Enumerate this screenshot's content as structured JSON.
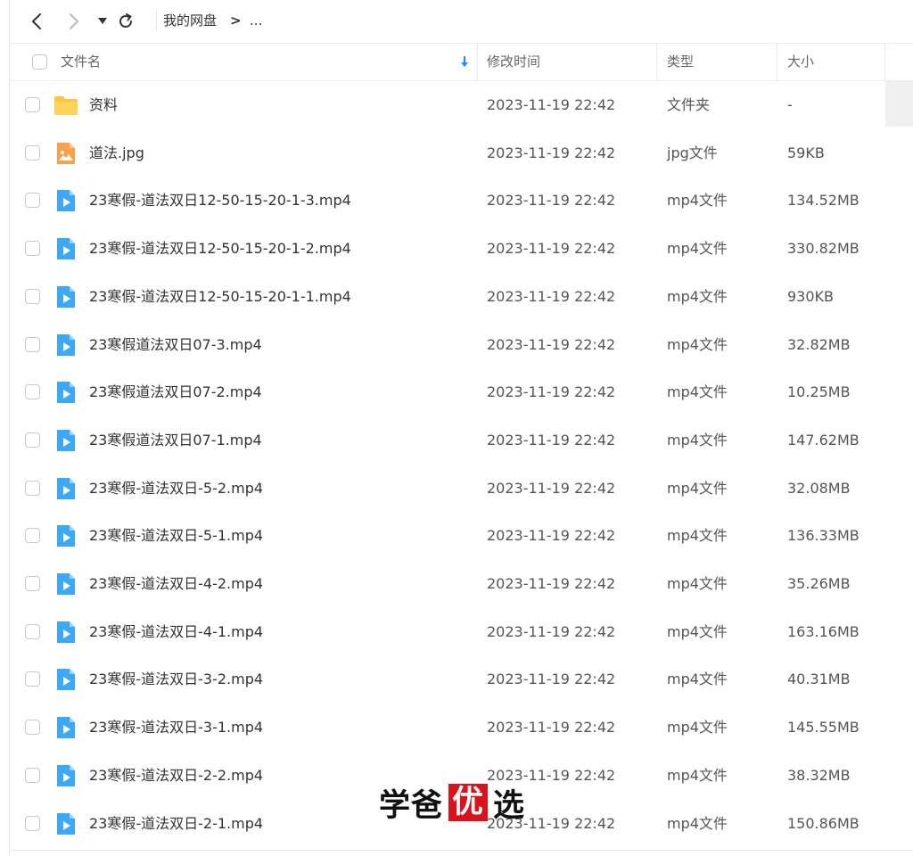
{
  "toolbar": {
    "breadcrumb_root": "我的网盘",
    "breadcrumb_sep": ">",
    "breadcrumb_more": "..."
  },
  "header": {
    "name": "文件名",
    "modified": "修改时间",
    "type": "类型",
    "size": "大小"
  },
  "files": [
    {
      "icon": "folder-icon",
      "name": "资料",
      "time": "2023-11-19 22:42",
      "type": "文件夹",
      "size": "-"
    },
    {
      "icon": "image-icon",
      "name": "道法.jpg",
      "time": "2023-11-19 22:42",
      "type": "jpg文件",
      "size": "59KB"
    },
    {
      "icon": "video-icon",
      "name": "23寒假-道法双日12-50-15-20-1-3.mp4",
      "time": "2023-11-19 22:42",
      "type": "mp4文件",
      "size": "134.52MB"
    },
    {
      "icon": "video-icon",
      "name": "23寒假-道法双日12-50-15-20-1-2.mp4",
      "time": "2023-11-19 22:42",
      "type": "mp4文件",
      "size": "330.82MB"
    },
    {
      "icon": "video-icon",
      "name": "23寒假-道法双日12-50-15-20-1-1.mp4",
      "time": "2023-11-19 22:42",
      "type": "mp4文件",
      "size": "930KB"
    },
    {
      "icon": "video-icon",
      "name": "23寒假道法双日07-3.mp4",
      "time": "2023-11-19 22:42",
      "type": "mp4文件",
      "size": "32.82MB"
    },
    {
      "icon": "video-icon",
      "name": "23寒假道法双日07-2.mp4",
      "time": "2023-11-19 22:42",
      "type": "mp4文件",
      "size": "10.25MB"
    },
    {
      "icon": "video-icon",
      "name": "23寒假道法双日07-1.mp4",
      "time": "2023-11-19 22:42",
      "type": "mp4文件",
      "size": "147.62MB"
    },
    {
      "icon": "video-icon",
      "name": "23寒假-道法双日-5-2.mp4",
      "time": "2023-11-19 22:42",
      "type": "mp4文件",
      "size": "32.08MB"
    },
    {
      "icon": "video-icon",
      "name": "23寒假-道法双日-5-1.mp4",
      "time": "2023-11-19 22:42",
      "type": "mp4文件",
      "size": "136.33MB"
    },
    {
      "icon": "video-icon",
      "name": "23寒假-道法双日-4-2.mp4",
      "time": "2023-11-19 22:42",
      "type": "mp4文件",
      "size": "35.26MB"
    },
    {
      "icon": "video-icon",
      "name": "23寒假-道法双日-4-1.mp4",
      "time": "2023-11-19 22:42",
      "type": "mp4文件",
      "size": "163.16MB"
    },
    {
      "icon": "video-icon",
      "name": "23寒假-道法双日-3-2.mp4",
      "time": "2023-11-19 22:42",
      "type": "mp4文件",
      "size": "40.31MB"
    },
    {
      "icon": "video-icon",
      "name": "23寒假-道法双日-3-1.mp4",
      "time": "2023-11-19 22:42",
      "type": "mp4文件",
      "size": "145.55MB"
    },
    {
      "icon": "video-icon",
      "name": "23寒假-道法双日-2-2.mp4",
      "time": "2023-11-19 22:42",
      "type": "mp4文件",
      "size": "38.32MB"
    },
    {
      "icon": "video-icon",
      "name": "23寒假-道法双日-2-1.mp4",
      "time": "2023-11-19 22:42",
      "type": "mp4文件",
      "size": "150.86MB"
    }
  ],
  "watermark": {
    "part1": "学爸",
    "part2": "优",
    "part3": "选"
  },
  "colors": {
    "accent": "#1a8cff",
    "folder": "#ffc53d",
    "image": "#f7a14a",
    "video": "#3da8f5",
    "watermark_red": "#d9131c"
  }
}
